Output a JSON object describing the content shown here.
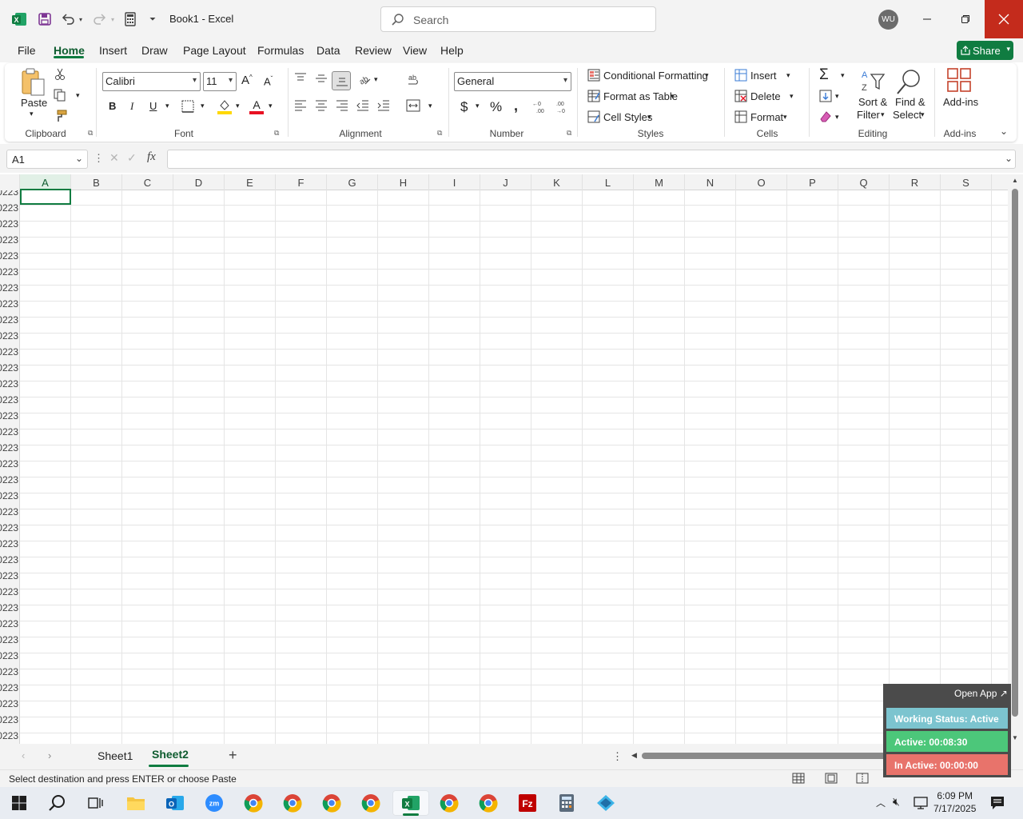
{
  "titlebar": {
    "title": "Book1 - Excel",
    "search_placeholder": "Search",
    "avatar_initials": "WU"
  },
  "menu": {
    "tabs": [
      "File",
      "Home",
      "Insert",
      "Draw",
      "Page Layout",
      "Formulas",
      "Data",
      "Review",
      "View",
      "Help"
    ],
    "share_label": "Share"
  },
  "ribbon": {
    "clipboard": {
      "paste_label": "Paste",
      "group_label": "Clipboard"
    },
    "font": {
      "font_name": "Calibri",
      "font_size": "11",
      "bold": "B",
      "italic": "I",
      "underline": "U",
      "group_label": "Font"
    },
    "alignment": {
      "group_label": "Alignment"
    },
    "number": {
      "format": "General",
      "group_label": "Number"
    },
    "styles": {
      "conditional_formatting": "Conditional Formatting",
      "format_as_table": "Format as Table",
      "cell_styles": "Cell Styles",
      "group_label": "Styles"
    },
    "cells": {
      "insert": "Insert",
      "delete": "Delete",
      "format": "Format",
      "group_label": "Cells"
    },
    "editing": {
      "sort_filter_1": "Sort &",
      "sort_filter_2": "Filter",
      "find_select_1": "Find &",
      "find_select_2": "Select",
      "group_label": "Editing"
    },
    "addins": {
      "label": "Add-ins",
      "group_label": "Add-ins"
    }
  },
  "formula_bar": {
    "name_box": "A1",
    "formula": ""
  },
  "grid": {
    "columns": [
      "A",
      "B",
      "C",
      "D",
      "E",
      "F",
      "G",
      "H",
      "I",
      "J",
      "K",
      "L",
      "M",
      "N",
      "O",
      "P",
      "Q",
      "R",
      "S"
    ],
    "row_label": "0223"
  },
  "sheets": {
    "tabs": [
      "Sheet1",
      "Sheet2"
    ],
    "active": "Sheet2"
  },
  "status": {
    "message": "Select destination and press ENTER or choose Paste"
  },
  "widget": {
    "open_app": "Open App ↗",
    "working_status": "Working Status: Active",
    "active_time": "Active: 00:08:30",
    "inactive_time": "In Active: 00:00:00",
    "colors": {
      "status": "#7cc4cf",
      "active": "#4cc77a",
      "inactive": "#e8736b"
    }
  },
  "taskbar": {
    "time": "6:09 PM",
    "date": "7/17/2025"
  },
  "colors": {
    "excel_green": "#107c41",
    "font_color_red": "#e81123",
    "highlight_yellow": "#ffd800"
  }
}
